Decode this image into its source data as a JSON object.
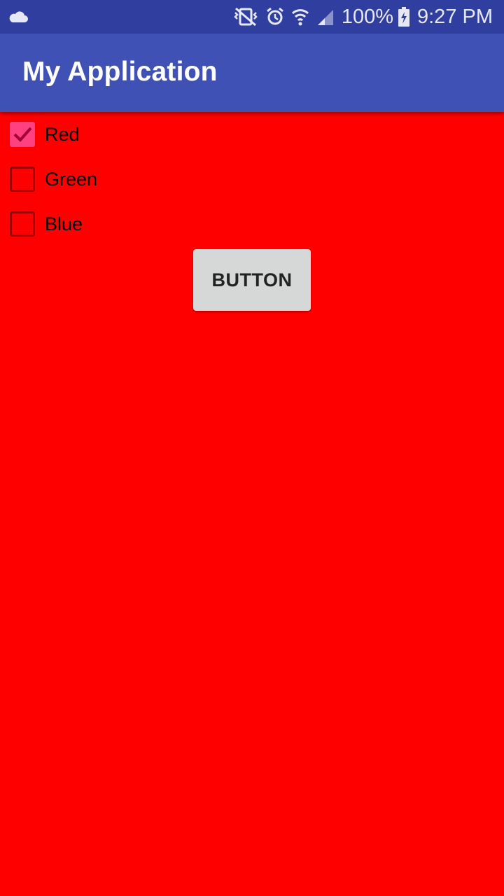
{
  "status_bar": {
    "left_icon": "cloud-icon",
    "icons": [
      "vibrate-mute-icon",
      "alarm-icon",
      "wifi-icon",
      "signal-icon",
      "battery-charging-icon"
    ],
    "battery_percent": "100%",
    "time": "9:27 PM"
  },
  "app_bar": {
    "title": "My Application"
  },
  "checkboxes": [
    {
      "label": "Red",
      "checked": true
    },
    {
      "label": "Green",
      "checked": false
    },
    {
      "label": "Blue",
      "checked": false
    }
  ],
  "button": {
    "label": "BUTTON"
  },
  "colors": {
    "status_bar": "#303f9f",
    "app_bar": "#3f51b5",
    "background": "#ff0000",
    "checkbox_accent": "#ff4081",
    "button_bg": "#d6d7d7"
  }
}
